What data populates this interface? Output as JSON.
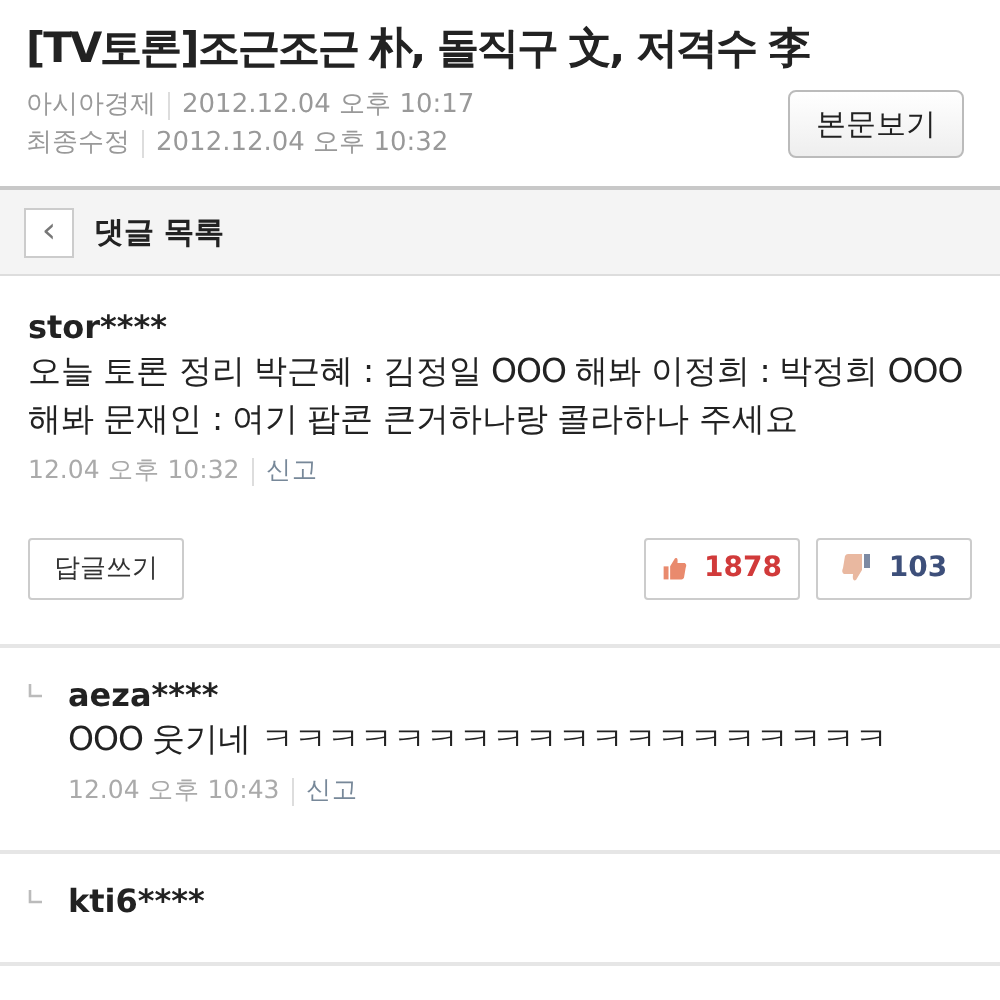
{
  "article": {
    "title": "[TV토론]조근조근 朴, 돌직구 文, 저격수 李",
    "meta": [
      {
        "label": "아시아경제",
        "value": "2012.12.04 오후 10:17"
      },
      {
        "label": "최종수정",
        "value": "2012.12.04 오후 10:32"
      }
    ],
    "view_button": "본문보기"
  },
  "header_bar": {
    "back_icon": "‹",
    "title": "댓글 목록"
  },
  "comments": [
    {
      "kind": "comment",
      "user": "stor****",
      "body": "오늘 토론 정리 박근혜 : 김정일 OOO 해봐 이정희 : 박정희 OOO 해봐 문재인 : 여기 팝콘 큰거하나랑 콜라하나 주세요",
      "time": "12.04 오후 10:32",
      "report": "신고",
      "reply_button": "답글쓰기",
      "likes": "1878",
      "dislikes": "103"
    },
    {
      "kind": "reply",
      "user": "aeza****",
      "body": "OOO 웃기네 ㅋㅋㅋㅋㅋㅋㅋㅋㅋㅋㅋㅋㅋㅋㅋㅋㅋㅋㅋ",
      "time": "12.04 오후 10:43",
      "report": "신고"
    },
    {
      "kind": "reply",
      "user": "kti6****"
    }
  ]
}
